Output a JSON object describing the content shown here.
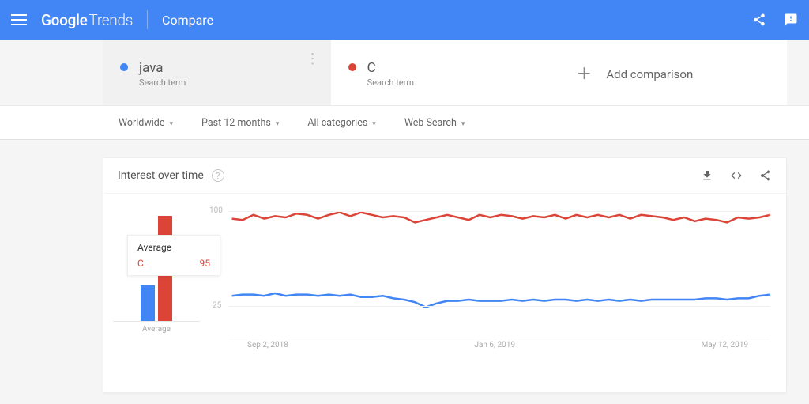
{
  "header": {
    "brand1": "Google",
    "brand2": "Trends",
    "page": "Compare"
  },
  "terms": [
    {
      "label": "java",
      "sub": "Search term",
      "color": "#4285f4"
    },
    {
      "label": "C",
      "sub": "Search term",
      "color": "#db4437"
    }
  ],
  "add_label": "Add comparison",
  "filters": {
    "geo": "Worldwide",
    "time": "Past 12 months",
    "cat": "All categories",
    "type": "Web Search"
  },
  "chart": {
    "title": "Interest over time"
  },
  "y_ticks": [
    "100",
    "25"
  ],
  "x_ticks": [
    "Sep 2, 2018",
    "Jan 6, 2019",
    "May 12, 2019"
  ],
  "avg_label": "Average",
  "tooltip": {
    "title": "Average",
    "label": "C",
    "value": "95"
  },
  "chart_data": {
    "type": "line",
    "ylabel": "",
    "xlabel": "",
    "ylim": [
      0,
      100
    ],
    "x_sample": [
      "Sep 2, 2018",
      "Jan 6, 2019",
      "May 12, 2019"
    ],
    "series": [
      {
        "name": "java",
        "avg": 32,
        "color": "#4285f4",
        "values": [
          33,
          34,
          34,
          33,
          35,
          33,
          34,
          34,
          33,
          34,
          33,
          34,
          32,
          32,
          33,
          31,
          30,
          28,
          24,
          27,
          29,
          29,
          30,
          29,
          29,
          29,
          30,
          29,
          30,
          29,
          30,
          30,
          29,
          30,
          29,
          30,
          29,
          30,
          29,
          30,
          30,
          30,
          30,
          30,
          31,
          31,
          30,
          31,
          31,
          33,
          34
        ]
      },
      {
        "name": "C",
        "avg": 95,
        "color": "#db4437",
        "values": [
          94,
          93,
          97,
          94,
          96,
          95,
          98,
          97,
          94,
          97,
          99,
          96,
          99,
          97,
          95,
          96,
          95,
          91,
          93,
          95,
          97,
          95,
          93,
          97,
          95,
          97,
          96,
          94,
          96,
          95,
          97,
          94,
          97,
          95,
          97,
          95,
          97,
          94,
          97,
          96,
          95,
          93,
          95,
          92,
          94,
          93,
          91,
          95,
          94,
          95,
          97
        ]
      }
    ]
  }
}
